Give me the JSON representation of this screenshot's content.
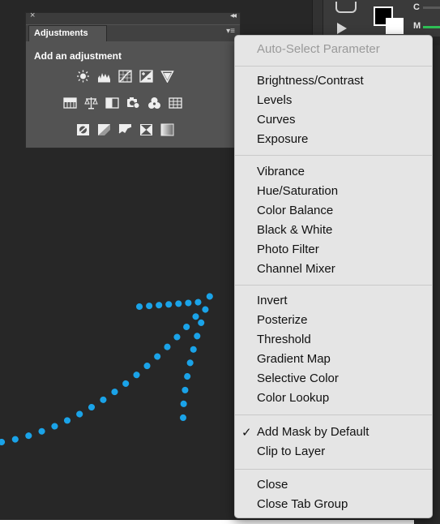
{
  "panel": {
    "close_glyph": "×",
    "collapse_glyph": "◂◂",
    "tab_label": "Adjustments",
    "menu_glyph": "▾≡",
    "heading": "Add an adjustment"
  },
  "toolbar": {
    "channel_c": "C",
    "channel_m": "M"
  },
  "menu": {
    "auto_select": "Auto-Select Parameter",
    "group1": [
      "Brightness/Contrast",
      "Levels",
      "Curves",
      "Exposure"
    ],
    "group2": [
      "Vibrance",
      "Hue/Saturation",
      "Color Balance",
      "Black & White",
      "Photo Filter",
      "Channel Mixer"
    ],
    "group3": [
      "Invert",
      "Posterize",
      "Threshold",
      "Gradient Map",
      "Selective Color",
      "Color Lookup"
    ],
    "check_glyph": "✓",
    "group4": [
      "Add Mask by Default",
      "Clip to Layer"
    ],
    "group5": [
      "Close",
      "Close Tab Group"
    ]
  },
  "colors": {
    "arrow": "#1aa3e8",
    "menu_bg": "#e5e5e5",
    "panel_bg": "#535353",
    "canvas_bg": "#272727"
  }
}
